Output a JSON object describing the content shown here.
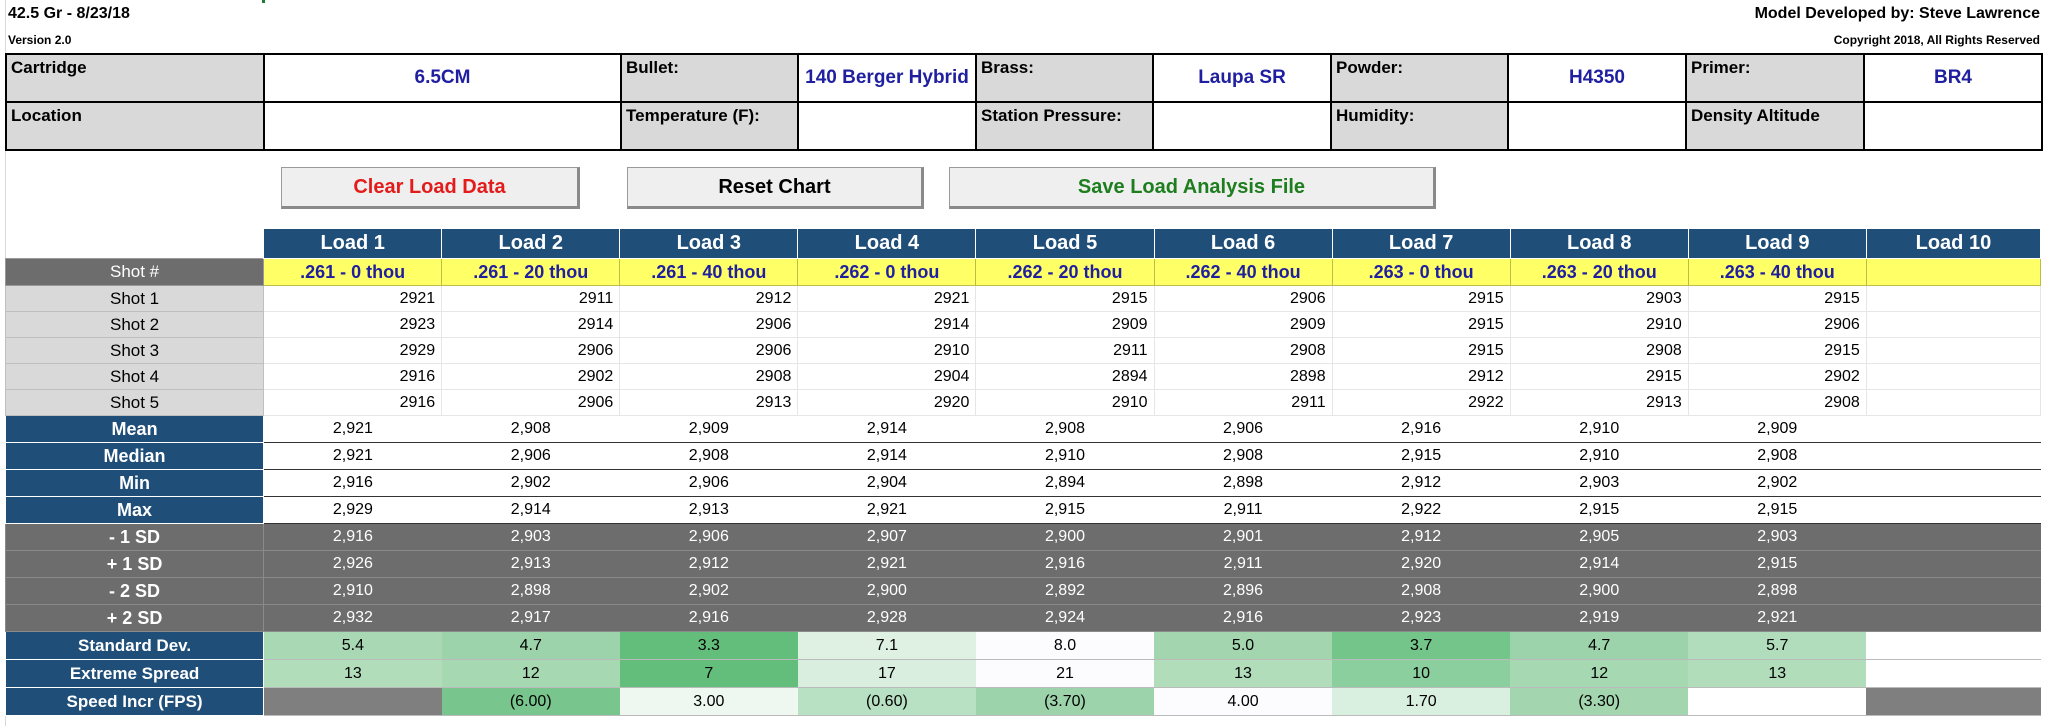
{
  "header": {
    "title": "42.5 Gr - 8/23/18",
    "version": "Version 2.0",
    "developer": "Model Developed by: Steve Lawrence",
    "copyright": "Copyright 2018, All Rights Reserved"
  },
  "info": {
    "row1": [
      {
        "label": "Cartridge",
        "value": "6.5CM"
      },
      {
        "label": "Bullet:",
        "value": "140 Berger Hybrid"
      },
      {
        "label": "Brass:",
        "value": "Laupa SR"
      },
      {
        "label": "Powder:",
        "value": "H4350"
      },
      {
        "label": "Primer:",
        "value": "BR4"
      }
    ],
    "row2": [
      {
        "label": "Location",
        "value": ""
      },
      {
        "label": "Temperature (F):",
        "value": ""
      },
      {
        "label": "Station Pressure:",
        "value": ""
      },
      {
        "label": "Humidity:",
        "value": ""
      },
      {
        "label": "Density Altitude",
        "value": ""
      }
    ]
  },
  "buttons": {
    "clear": "Clear Load Data",
    "reset": "Reset Chart",
    "save": "Save Load Analysis File"
  },
  "grid": {
    "loads": [
      "Load 1",
      "Load 2",
      "Load 3",
      "Load 4",
      "Load 5",
      "Load 6",
      "Load 7",
      "Load 8",
      "Load 9",
      "Load 10"
    ],
    "shot_header": "Shot #",
    "seating": [
      ".261 - 0 thou",
      ".261 - 20 thou",
      ".261 - 40 thou",
      ".262 - 0 thou",
      ".262 - 20 thou",
      ".262 - 40 thou",
      ".263 - 0 thou",
      ".263 - 20 thou",
      ".263 - 40 thou",
      ""
    ],
    "shots": [
      {
        "label": "Shot 1",
        "values": [
          "2921",
          "2911",
          "2912",
          "2921",
          "2915",
          "2906",
          "2915",
          "2903",
          "2915",
          ""
        ]
      },
      {
        "label": "Shot 2",
        "values": [
          "2923",
          "2914",
          "2906",
          "2914",
          "2909",
          "2909",
          "2915",
          "2910",
          "2906",
          ""
        ]
      },
      {
        "label": "Shot 3",
        "values": [
          "2929",
          "2906",
          "2906",
          "2910",
          "2911",
          "2908",
          "2915",
          "2908",
          "2915",
          ""
        ]
      },
      {
        "label": "Shot 4",
        "values": [
          "2916",
          "2902",
          "2908",
          "2904",
          "2894",
          "2898",
          "2912",
          "2915",
          "2902",
          ""
        ]
      },
      {
        "label": "Shot 5",
        "values": [
          "2916",
          "2906",
          "2913",
          "2920",
          "2910",
          "2911",
          "2922",
          "2913",
          "2908",
          ""
        ]
      }
    ],
    "stats": [
      {
        "label": "Mean",
        "values": [
          "2,921",
          "2,908",
          "2,909",
          "2,914",
          "2,908",
          "2,906",
          "2,916",
          "2,910",
          "2,909",
          ""
        ]
      },
      {
        "label": "Median",
        "values": [
          "2,921",
          "2,906",
          "2,908",
          "2,914",
          "2,910",
          "2,908",
          "2,915",
          "2,910",
          "2,908",
          ""
        ]
      },
      {
        "label": "Min",
        "values": [
          "2,916",
          "2,902",
          "2,906",
          "2,904",
          "2,894",
          "2,898",
          "2,912",
          "2,903",
          "2,902",
          ""
        ]
      },
      {
        "label": "Max",
        "values": [
          "2,929",
          "2,914",
          "2,913",
          "2,921",
          "2,915",
          "2,911",
          "2,922",
          "2,915",
          "2,915",
          ""
        ]
      }
    ],
    "sd_bands": [
      {
        "label": "- 1 SD",
        "values": [
          "2,916",
          "2,903",
          "2,906",
          "2,907",
          "2,900",
          "2,901",
          "2,912",
          "2,905",
          "2,903",
          ""
        ]
      },
      {
        "label": "+ 1 SD",
        "values": [
          "2,926",
          "2,913",
          "2,912",
          "2,921",
          "2,916",
          "2,911",
          "2,920",
          "2,914",
          "2,915",
          ""
        ]
      },
      {
        "label": "- 2 SD",
        "values": [
          "2,910",
          "2,898",
          "2,902",
          "2,900",
          "2,892",
          "2,896",
          "2,908",
          "2,900",
          "2,898",
          ""
        ]
      },
      {
        "label": "+ 2 SD",
        "values": [
          "2,932",
          "2,917",
          "2,916",
          "2,928",
          "2,924",
          "2,916",
          "2,923",
          "2,919",
          "2,921",
          ""
        ]
      }
    ],
    "metrics": [
      {
        "label": "Standard Dev.",
        "values": [
          "5.4",
          "4.7",
          "3.3",
          "7.1",
          "8.0",
          "5.0",
          "3.7",
          "4.7",
          "5.7",
          ""
        ],
        "colors": [
          "#a9d9b4",
          "#9cd3aa",
          "#63be7b",
          "#dff1e3",
          "#fcfcff",
          "#a3d6ae",
          "#74c589",
          "#9cd3aa",
          "#b2ddbd",
          "#ffffff"
        ]
      },
      {
        "label": "Extreme Spread",
        "values": [
          "13",
          "12",
          "7",
          "17",
          "21",
          "13",
          "10",
          "12",
          "13",
          ""
        ],
        "colors": [
          "#b1ddbb",
          "#a6d8b2",
          "#63be7b",
          "#d9eedf",
          "#fcfcff",
          "#b1ddbb",
          "#8ccf9e",
          "#a6d8b2",
          "#b1ddbb",
          "#ffffff"
        ]
      },
      {
        "label": "Speed Incr (FPS)",
        "values": [
          "",
          "(6.00)",
          "3.00",
          "(0.60)",
          "(3.70)",
          "4.00",
          "1.70",
          "(3.30)",
          "",
          ""
        ],
        "colors": [
          "#7f7f7f",
          "#78c68d",
          "#eef8f1",
          "#b8e0c3",
          "#9dd3ab",
          "#fcfcff",
          "#d9efe0",
          "#a3d6ae",
          "#ffffff",
          "#7f7f7f"
        ]
      }
    ]
  }
}
